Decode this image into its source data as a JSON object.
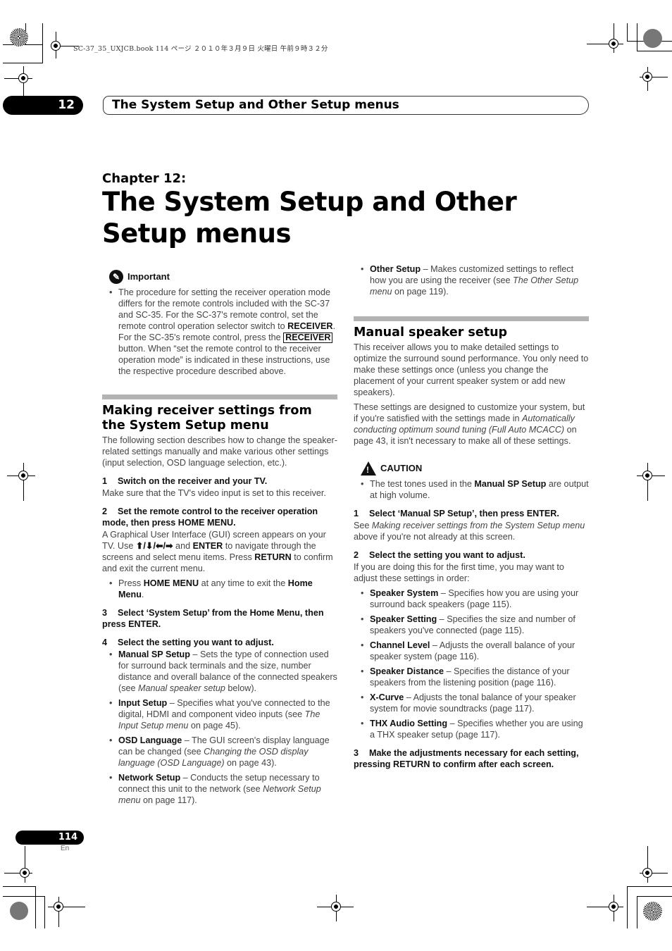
{
  "print_info": "SC-37_35_UXJCB.book  114 ページ  ２０１０年３月９日  火曜日  午前９時３２分",
  "header": {
    "chapter_number": "12",
    "running_title": "The System Setup and Other Setup menus"
  },
  "chapter": {
    "label": "Chapter 12:",
    "title": "The System Setup and Other Setup menus"
  },
  "left_column": {
    "important": {
      "icon": "important-pin-icon",
      "heading": "Important",
      "bullet": {
        "t1": "The procedure for setting the receiver operation mode differs for the remote controls included with the SC-37 and SC-35. For the SC-37's remote control, set the remote control operation selector switch to ",
        "b1": "RECEIVER",
        "t2": ". For the SC-35's remote control, press the ",
        "button": "RECEIVER",
        "t3": " button. When “set the remote control to the receiver operation mode” is indicated in these instructions, use the respective procedure described above."
      }
    },
    "section": {
      "heading": "Making receiver settings from the System Setup menu",
      "intro": "The following section describes how to change the speaker-related settings manually and make various other settings (input selection, OSD language selection, etc.).",
      "step1": {
        "num": "1",
        "title": "Switch on the receiver and your TV.",
        "text": "Make sure that the TV's video input is set to this receiver."
      },
      "step2": {
        "num": "2",
        "title": "Set the remote control to the receiver operation mode, then press HOME MENU.",
        "t1": "A Graphical User Interface (GUI) screen appears on your TV. Use ",
        "arrows": "⬆/⬇/⬅/➡",
        "t2": " and ",
        "b1": "ENTER",
        "t3": " to navigate through the screens and select menu items. Press ",
        "b2": "RETURN",
        "t4": " to confirm and exit the current menu.",
        "bullet": {
          "t1": "Press ",
          "b1": "HOME MENU",
          "t2": " at any time to exit the ",
          "b2": "Home Menu",
          "t3": "."
        }
      },
      "step3": {
        "num": "3",
        "title": "Select ‘System Setup’ from the Home Menu, then press ENTER."
      },
      "step4": {
        "num": "4",
        "title": "Select the setting you want to adjust.",
        "items": [
          {
            "label": "Manual SP Setup",
            "t1": " – Sets the type of connection used for surround back terminals and the size, number distance and overall balance of the connected speakers (see ",
            "ref": "Manual speaker setup",
            "t2": " below)."
          },
          {
            "label": "Input Setup",
            "t1": " – Specifies what you've connected to the digital, HDMI and component video inputs (see ",
            "ref": "The Input Setup menu",
            "t2": " on page 45)."
          },
          {
            "label": "OSD Language",
            "t1": " – The GUI screen's display language can be changed (see ",
            "ref": "Changing the OSD display language (OSD Language)",
            "t2": " on page 43)."
          },
          {
            "label": "Network Setup",
            "t1": " – Conducts the setup necessary to connect this unit to the network (see ",
            "ref": "Network Setup menu",
            "t2": " on page 117)."
          }
        ]
      }
    }
  },
  "right_column": {
    "other_setup": {
      "label": "Other Setup",
      "t1": " – Makes customized settings to reflect how you are using the receiver (see ",
      "ref": "The Other Setup menu",
      "t2": " on page 119)."
    },
    "section": {
      "heading": "Manual speaker setup",
      "p1": "This receiver allows you to make detailed settings to optimize the surround sound performance. You only need to make these settings once (unless you change the placement of your current speaker system or add new speakers).",
      "p2_t1": "These settings are designed to customize your system, but if you're satisfied with the settings made in ",
      "p2_ref": "Automatically conducting optimum sound tuning (Full Auto MCACC)",
      "p2_t2": " on page 43, it isn't necessary to make all of these settings."
    },
    "caution": {
      "icon": "caution-triangle-icon",
      "heading": "CAUTION",
      "t1": "The test tones used in the ",
      "b1": "Manual SP Setup",
      "t2": " are output at high volume."
    },
    "step1": {
      "num": "1",
      "title": "Select ‘Manual SP Setup’, then press ENTER.",
      "t1": "See ",
      "ref": "Making receiver settings from the System Setup menu",
      "t2": " above if you're not already at this screen."
    },
    "step2": {
      "num": "2",
      "title": "Select the setting you want to adjust.",
      "text": "If you are doing this for the first time, you may want to adjust these settings in order:",
      "items": [
        {
          "label": "Speaker System",
          "text": " – Specifies how you are using your surround back speakers (page 115)."
        },
        {
          "label": "Speaker Setting",
          "text": " – Specifies the size and number of speakers you've connected (page 115)."
        },
        {
          "label": "Channel Level",
          "text": " – Adjusts the overall balance of your speaker system (page 116)."
        },
        {
          "label": "Speaker Distance",
          "text": " – Specifies the distance of your speakers from the listening position (page 116)."
        },
        {
          "label": "X-Curve",
          "text": " – Adjusts the tonal balance of your speaker system for movie soundtracks (page 117)."
        },
        {
          "label": "THX Audio Setting",
          "text": " – Specifies whether you are using a THX speaker setup (page 117)."
        }
      ]
    },
    "step3": {
      "num": "3",
      "title": "Make the adjustments necessary for each setting, pressing RETURN to confirm after each screen."
    }
  },
  "footer": {
    "page_number": "114",
    "language": "En"
  }
}
